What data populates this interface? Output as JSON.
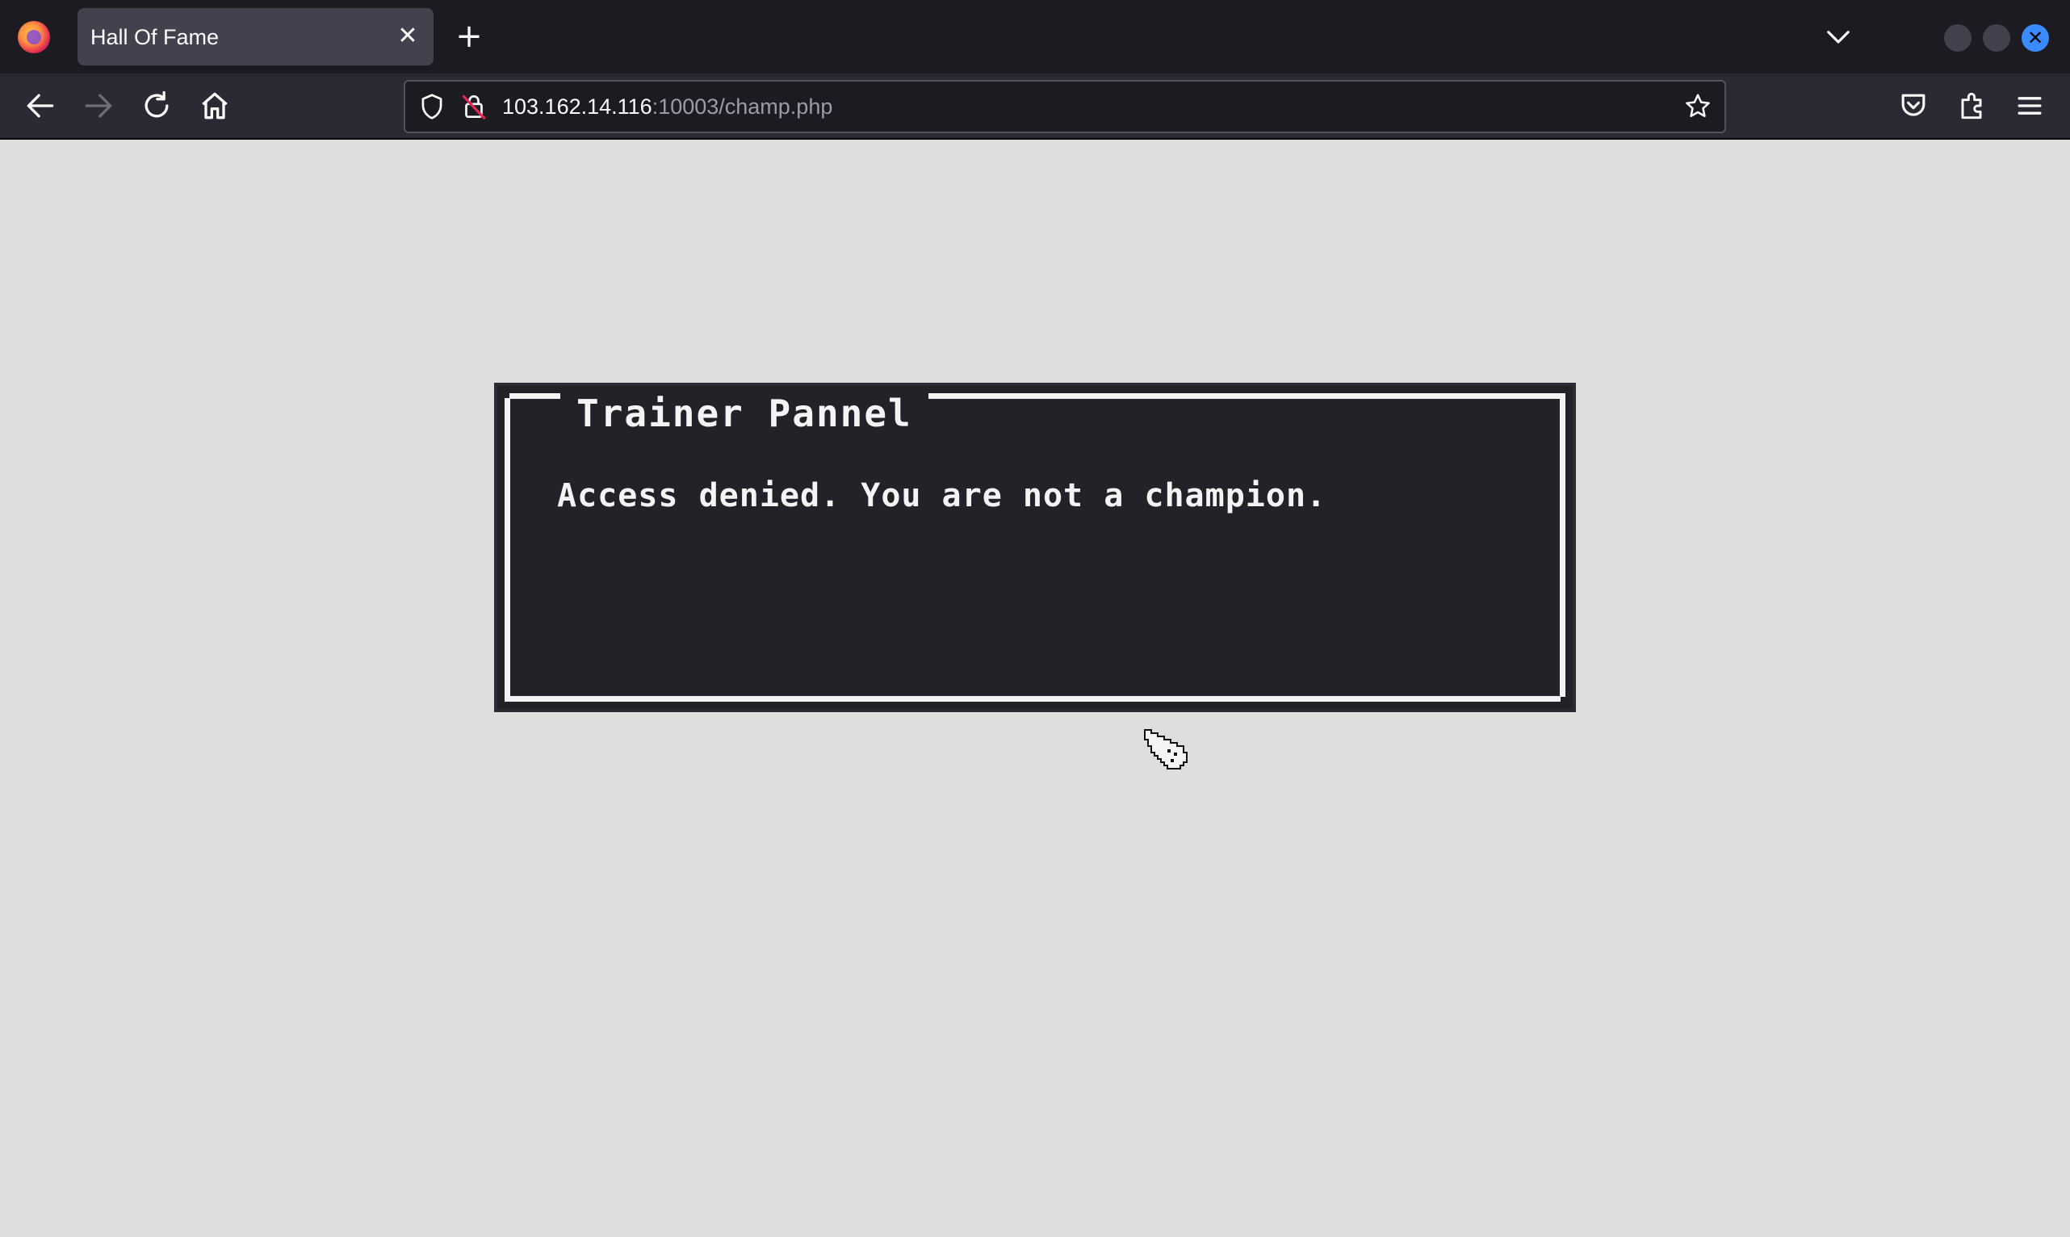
{
  "browser": {
    "tab": {
      "title": "Hall Of Fame",
      "close_glyph": "✕"
    },
    "newtab_glyph": "+",
    "url": {
      "host": "103.162.14.116",
      "path": ":10003/champ.php"
    },
    "window_close_glyph": "✕"
  },
  "panel": {
    "title": "Trainer Pannel",
    "message": "Access denied. You are not a champion."
  },
  "colors": {
    "page_bg": "#dedede",
    "panel_bg": "#212329",
    "panel_border": "#f4f4f4",
    "tabstrip_bg": "#1c1b22",
    "navbar_bg": "#2b2a33",
    "accent": "#3a8bff"
  },
  "icons": [
    "firefox-logo-icon",
    "close-icon",
    "plus-icon",
    "chevron-down-icon",
    "back-arrow-icon",
    "forward-arrow-icon",
    "reload-icon",
    "home-icon",
    "shield-icon",
    "lock-slash-icon",
    "star-icon",
    "pocket-icon",
    "extensions-icon",
    "hamburger-menu-icon",
    "hand-cursor-icon"
  ]
}
